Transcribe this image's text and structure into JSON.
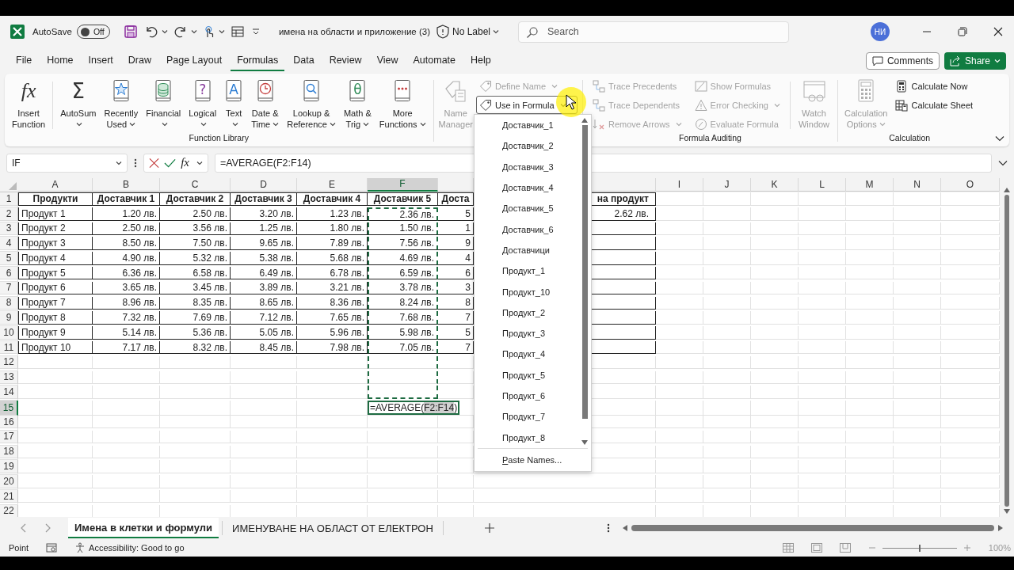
{
  "title_bar": {
    "autosave_label": "AutoSave",
    "autosave_toggle": {
      "label": "Off",
      "on": false
    },
    "document_title": "имена на области и приложение (3)",
    "sensitivity": "No Label",
    "search_placeholder": "Search",
    "avatar_initials": "НИ"
  },
  "menu_tabs": [
    {
      "label": "File",
      "selected": false
    },
    {
      "label": "Home",
      "selected": false
    },
    {
      "label": "Insert",
      "selected": false
    },
    {
      "label": "Draw",
      "selected": false
    },
    {
      "label": "Page Layout",
      "selected": false
    },
    {
      "label": "Formulas",
      "selected": true
    },
    {
      "label": "Data",
      "selected": false
    },
    {
      "label": "Review",
      "selected": false
    },
    {
      "label": "View",
      "selected": false
    },
    {
      "label": "Automate",
      "selected": false
    },
    {
      "label": "Help",
      "selected": false
    }
  ],
  "comments_button": "Comments",
  "share_button": "Share",
  "ribbon": {
    "groups": [
      {
        "label": "Function Library",
        "blocks": [
          {
            "kind": "large",
            "glyph": "fx",
            "lines": [
              "Insert",
              "Function"
            ],
            "dropdown": false,
            "disabled": false
          },
          {
            "kind": "separator"
          },
          {
            "kind": "large",
            "glyph": "Σ",
            "lines": [
              "AutoSum"
            ],
            "dropdown": true,
            "disabled": false
          },
          {
            "kind": "large",
            "lines": [
              "Recently",
              "Used"
            ],
            "dropdown": true,
            "disabled": false
          },
          {
            "kind": "large",
            "lines": [
              "Financial"
            ],
            "dropdown": true,
            "disabled": false
          },
          {
            "kind": "large",
            "glyph": "?",
            "lines": [
              "Logical"
            ],
            "dropdown": true,
            "disabled": false
          },
          {
            "kind": "large",
            "glyph": "A",
            "lines": [
              "Text"
            ],
            "dropdown": true,
            "disabled": false
          },
          {
            "kind": "large",
            "lines": [
              "Date &",
              "Time"
            ],
            "dropdown": true,
            "disabled": false
          },
          {
            "kind": "large",
            "lines": [
              "Lookup &",
              "Reference"
            ],
            "dropdown": true,
            "disabled": false
          },
          {
            "kind": "large",
            "glyph": "θ",
            "lines": [
              "Math &",
              "Trig"
            ],
            "dropdown": true,
            "disabled": false
          },
          {
            "kind": "large",
            "lines": [
              "More",
              "Functions"
            ],
            "dropdown": true,
            "disabled": false
          }
        ]
      },
      {
        "blocks": [
          {
            "kind": "large",
            "lines": [
              "Name",
              "Manager"
            ],
            "dropdown": false,
            "disabled": true
          },
          {
            "kind": "stack",
            "items": [
              {
                "label": "Define Name",
                "dropdown": true,
                "disabled": true,
                "open": false
              },
              {
                "label": "Use in Formula",
                "dropdown": true,
                "disabled": false,
                "open": true
              }
            ]
          }
        ]
      },
      {
        "label": "Formula Auditing",
        "blocks": [
          {
            "kind": "stack",
            "items": [
              {
                "label": "Trace Precedents",
                "dropdown": false,
                "disabled": true
              },
              {
                "label": "Trace Dependents",
                "dropdown": false,
                "disabled": true
              },
              {
                "label": "Remove Arrows",
                "dropdown": true,
                "disabled": true
              }
            ]
          },
          {
            "kind": "stack",
            "items": [
              {
                "label": "Show Formulas",
                "dropdown": false,
                "disabled": true
              },
              {
                "label": "Error Checking",
                "dropdown": true,
                "disabled": true
              },
              {
                "label": "Evaluate Formula",
                "dropdown": false,
                "disabled": true
              }
            ]
          },
          {
            "kind": "separator"
          },
          {
            "kind": "large",
            "lines": [
              "Watch",
              "Window"
            ],
            "dropdown": false,
            "disabled": true
          }
        ]
      },
      {
        "label": "Calculation",
        "blocks": [
          {
            "kind": "large",
            "lines": [
              "Calculation",
              "Options"
            ],
            "dropdown": true,
            "disabled": true
          },
          {
            "kind": "stack",
            "items": [
              {
                "label": "Calculate Now",
                "dropdown": false,
                "disabled": false
              },
              {
                "label": "Calculate Sheet",
                "dropdown": false,
                "disabled": false
              }
            ]
          }
        ]
      }
    ]
  },
  "formula_bar": {
    "name_box": "IF",
    "function_glyph": "fx",
    "formula": "=AVERAGE(F2:F14)"
  },
  "grid": {
    "columns": [
      {
        "letter": "A",
        "selected": false,
        "range": false
      },
      {
        "letter": "B",
        "selected": false,
        "range": false
      },
      {
        "letter": "C",
        "selected": false,
        "range": false
      },
      {
        "letter": "D",
        "selected": false,
        "range": false
      },
      {
        "letter": "E",
        "selected": false,
        "range": false
      },
      {
        "letter": "F",
        "selected": true,
        "range": true
      },
      {
        "selected": false,
        "range": false
      },
      {
        "selected": false,
        "range": false
      },
      {
        "letter": "I",
        "selected": false,
        "range": false
      },
      {
        "letter": "J",
        "selected": false,
        "range": false
      },
      {
        "letter": "K",
        "selected": false,
        "range": false
      },
      {
        "letter": "L",
        "selected": false,
        "range": false
      },
      {
        "letter": "M",
        "selected": false,
        "range": false
      },
      {
        "letter": "N",
        "selected": false,
        "range": false
      },
      {
        "letter": "O",
        "selected": false,
        "range": false
      }
    ],
    "rows": [
      {
        "number": "1",
        "selected": false,
        "kind": "header",
        "marked": false,
        "cells": [
          "Продукти",
          "Доставчик 1",
          "Доставчик 2",
          "Доставчик 3",
          "Доставчик 4",
          "Доставчик 5",
          "Доста",
          "на продукт"
        ]
      },
      {
        "number": "2",
        "selected": false,
        "kind": "data",
        "marked": true,
        "cells": [
          "Продукт 1",
          "1.20 лв.",
          "2.50 лв.",
          "3.20 лв.",
          "1.23 лв.",
          "2.36 лв.",
          "5",
          "2.62 лв."
        ]
      },
      {
        "number": "3",
        "selected": false,
        "kind": "data",
        "marked": true,
        "cells": [
          "Продукт 2",
          "2.50 лв.",
          "3.56 лв.",
          "1.25 лв.",
          "1.80 лв.",
          "1.50 лв.",
          "1",
          null
        ]
      },
      {
        "number": "4",
        "selected": false,
        "kind": "data",
        "marked": true,
        "cells": [
          "Продукт 3",
          "8.50 лв.",
          "7.50 лв.",
          "9.65 лв.",
          "7.89 лв.",
          "7.56 лв.",
          "9",
          null
        ]
      },
      {
        "number": "5",
        "selected": false,
        "kind": "data",
        "marked": true,
        "cells": [
          "Продукт 4",
          "4.90 лв.",
          "5.32 лв.",
          "5.38 лв.",
          "5.68 лв.",
          "4.69 лв.",
          "4",
          null
        ]
      },
      {
        "number": "6",
        "selected": false,
        "kind": "data",
        "marked": true,
        "cells": [
          "Продукт 5",
          "6.36 лв.",
          "6.58 лв.",
          "6.49 лв.",
          "6.78 лв.",
          "6.59 лв.",
          "6",
          null
        ]
      },
      {
        "number": "7",
        "selected": false,
        "kind": "data",
        "marked": true,
        "cells": [
          "Продукт 6",
          "3.65 лв.",
          "3.45 лв.",
          "3.89 лв.",
          "3.21 лв.",
          "3.78 лв.",
          "3",
          null
        ]
      },
      {
        "number": "8",
        "selected": false,
        "kind": "data",
        "marked": true,
        "cells": [
          "Продукт 7",
          "8.96 лв.",
          "8.35 лв.",
          "8.65 лв.",
          "8.36 лв.",
          "8.24 лв.",
          "8",
          null
        ]
      },
      {
        "number": "9",
        "selected": false,
        "kind": "data",
        "marked": true,
        "cells": [
          "Продукт 8",
          "7.32 лв.",
          "7.69 лв.",
          "7.12 лв.",
          "7.65 лв.",
          "7.68 лв.",
          "7",
          null
        ]
      },
      {
        "number": "10",
        "selected": false,
        "kind": "data",
        "marked": true,
        "cells": [
          "Продукт 9",
          "5.14 лв.",
          "5.36 лв.",
          "5.05 лв.",
          "5.96 лв.",
          "5.98 лв.",
          "5",
          null
        ]
      },
      {
        "number": "11",
        "selected": false,
        "kind": "data",
        "marked": true,
        "cells": [
          "Продукт 10",
          "7.17 лв.",
          "8.32 лв.",
          "8.45 лв.",
          "7.98 лв.",
          "7.05 лв.",
          "7",
          null
        ]
      },
      {
        "number": "12",
        "selected": false,
        "kind": "blank",
        "marked": true
      },
      {
        "number": "13",
        "selected": false,
        "kind": "blank",
        "marked": true
      },
      {
        "number": "14",
        "selected": false,
        "kind": "blank",
        "marked": true
      },
      {
        "number": "15",
        "selected": true,
        "kind": "blank",
        "marked": false,
        "cells": [
          null,
          null,
          null,
          null,
          null,
          {
            "kind": "editor",
            "before": "=AVERAGE(",
            "reference": "F2:F14",
            "after": ")"
          }
        ]
      },
      {
        "number": "16",
        "selected": false,
        "kind": "blank",
        "marked": false
      },
      {
        "number": "17",
        "selected": false,
        "kind": "blank",
        "marked": false
      },
      {
        "number": "18",
        "selected": false,
        "kind": "blank",
        "marked": false
      },
      {
        "number": "19",
        "selected": false,
        "kind": "blank",
        "marked": false
      },
      {
        "number": "20",
        "selected": false,
        "kind": "blank",
        "marked": false
      },
      {
        "number": "21",
        "selected": false,
        "kind": "blank",
        "marked": false
      },
      {
        "number": "22",
        "selected": false,
        "kind": "blank",
        "marked": false
      }
    ]
  },
  "names_menu": {
    "items": [
      "Доставчик_1",
      "Доставчик_2",
      "Доставчик_3",
      "Доставчик_4",
      "Доставчик_5",
      "Доставчик_6",
      "Доставчици",
      "Продукт_1",
      "Продукт_10",
      "Продукт_2",
      "Продукт_3",
      "Продукт_4",
      "Продукт_5",
      "Продукт_6",
      "Продукт_7",
      "Продукт_8"
    ],
    "paste_names": "Paste Names..."
  },
  "sheet_tabs": [
    {
      "label": "Имена в клетки и формули",
      "selected": true
    },
    {
      "label": "ИМЕНУВАНЕ НА ОБЛАСТ ОТ ЕЛЕКТРОН",
      "selected": false
    }
  ],
  "status_bar": {
    "mode": "Point",
    "accessibility": "Accessibility: Good to go",
    "zoom": {
      "level": 0.5,
      "reading": "100%"
    }
  }
}
